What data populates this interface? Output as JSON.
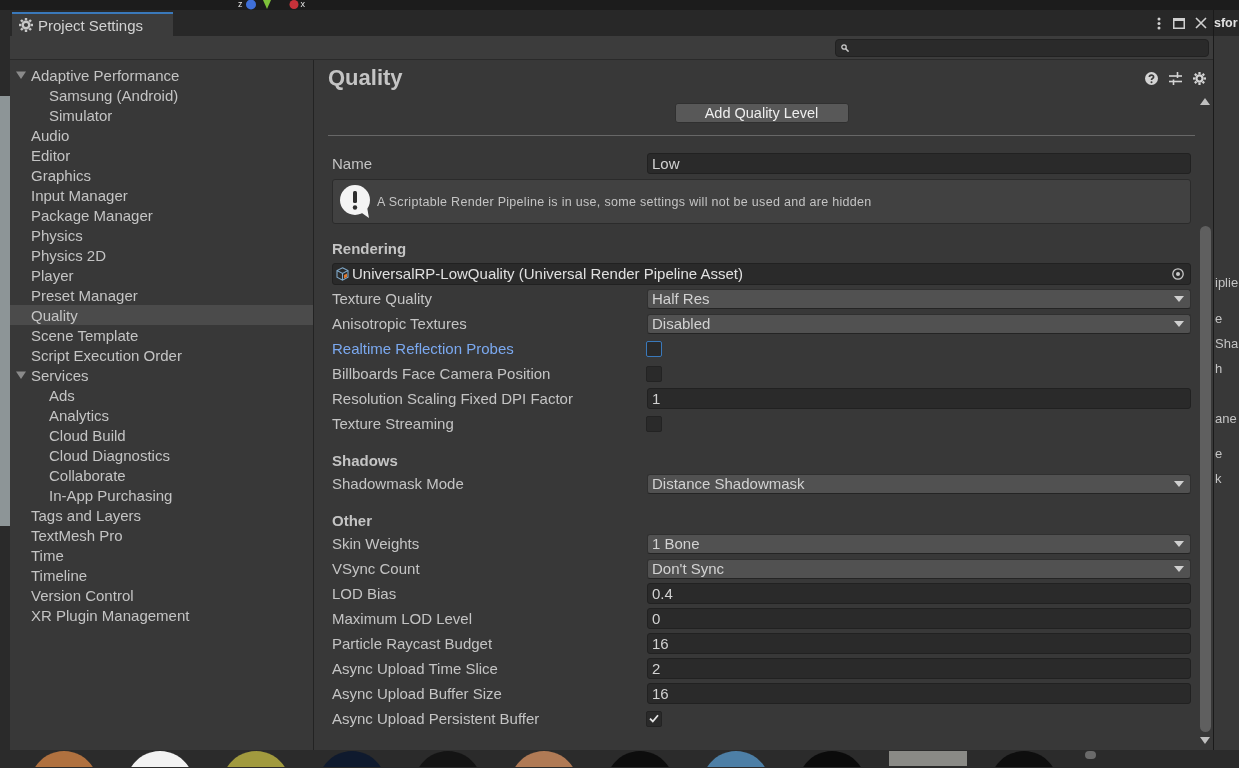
{
  "window": {
    "title": "Project Settings"
  },
  "sidebar": {
    "items": [
      {
        "label": "Adaptive Performance",
        "selected": false,
        "expanded": true,
        "children": [
          {
            "label": "Samsung (Android)",
            "selected": false
          },
          {
            "label": "Simulator",
            "selected": false
          }
        ]
      },
      {
        "label": "Audio",
        "selected": false
      },
      {
        "label": "Editor",
        "selected": false
      },
      {
        "label": "Graphics",
        "selected": false
      },
      {
        "label": "Input Manager",
        "selected": false
      },
      {
        "label": "Package Manager",
        "selected": false
      },
      {
        "label": "Physics",
        "selected": false
      },
      {
        "label": "Physics 2D",
        "selected": false
      },
      {
        "label": "Player",
        "selected": false
      },
      {
        "label": "Preset Manager",
        "selected": false
      },
      {
        "label": "Quality",
        "selected": true
      },
      {
        "label": "Scene Template",
        "selected": false
      },
      {
        "label": "Script Execution Order",
        "selected": false
      },
      {
        "label": "Services",
        "selected": false,
        "expanded": true,
        "children": [
          {
            "label": "Ads",
            "selected": false
          },
          {
            "label": "Analytics",
            "selected": false
          },
          {
            "label": "Cloud Build",
            "selected": false
          },
          {
            "label": "Cloud Diagnostics",
            "selected": false
          },
          {
            "label": "Collaborate",
            "selected": false
          },
          {
            "label": "In-App Purchasing",
            "selected": false
          }
        ]
      },
      {
        "label": "Tags and Layers",
        "selected": false
      },
      {
        "label": "TextMesh Pro",
        "selected": false
      },
      {
        "label": "Time",
        "selected": false
      },
      {
        "label": "Timeline",
        "selected": false
      },
      {
        "label": "Version Control",
        "selected": false
      },
      {
        "label": "XR Plugin Management",
        "selected": false
      }
    ]
  },
  "page": {
    "title": "Quality",
    "add_level_button": "Add Quality Level",
    "name": {
      "label": "Name",
      "value": "Low"
    },
    "notice": "A Scriptable Render Pipeline is in use, some settings will not be used and are hidden",
    "sections": [
      {
        "heading": "Rendering",
        "rows": [
          {
            "kind": "asset",
            "value": "UniversalRP-LowQuality (Universal Render Pipeline Asset)",
            "focused": false
          },
          {
            "kind": "dropdown",
            "label": "Texture Quality",
            "value": "Half Res",
            "focused": false
          },
          {
            "kind": "dropdown",
            "label": "Anisotropic Textures",
            "value": "Disabled",
            "focused": false
          },
          {
            "kind": "checkbox",
            "label": "Realtime Reflection Probes",
            "checked": false,
            "focused": true
          },
          {
            "kind": "checkbox",
            "label": "Billboards Face Camera Position",
            "checked": false,
            "focused": false
          },
          {
            "kind": "number",
            "label": "Resolution Scaling Fixed DPI Factor",
            "value": "1",
            "focused": false
          },
          {
            "kind": "checkbox",
            "label": "Texture Streaming",
            "checked": false,
            "focused": false
          }
        ]
      },
      {
        "heading": "Shadows",
        "rows": [
          {
            "kind": "dropdown",
            "label": "Shadowmask Mode",
            "value": "Distance Shadowmask",
            "focused": false
          }
        ]
      },
      {
        "heading": "Other",
        "rows": [
          {
            "kind": "dropdown",
            "label": "Skin Weights",
            "value": "1 Bone",
            "focused": false
          },
          {
            "kind": "dropdown",
            "label": "VSync Count",
            "value": "Don't Sync",
            "focused": false
          },
          {
            "kind": "number",
            "label": "LOD Bias",
            "value": "0.4",
            "focused": false
          },
          {
            "kind": "number",
            "label": "Maximum LOD Level",
            "value": "0",
            "focused": false
          },
          {
            "kind": "number",
            "label": "Particle Raycast Budget",
            "value": "16",
            "focused": false
          },
          {
            "kind": "number",
            "label": "Async Upload Time Slice",
            "value": "2",
            "focused": false
          },
          {
            "kind": "number",
            "label": "Async Upload Buffer Size",
            "value": "16",
            "focused": false
          },
          {
            "kind": "checkbox",
            "label": "Async Upload Persistent Buffer",
            "checked": true,
            "focused": false
          }
        ]
      }
    ]
  },
  "background": {
    "gizmo_labels": [
      "z",
      "x"
    ],
    "inspector_header": "sfor",
    "inspector_fragments": [
      "iplie",
      "e",
      "Sha",
      "h",
      "ane",
      "e",
      "k"
    ],
    "material_previews": [
      {
        "kind": "sphere",
        "color": "#b0713f"
      },
      {
        "kind": "sphere",
        "color": "#f2f2f2"
      },
      {
        "kind": "sphere",
        "color": "#a19a3e"
      },
      {
        "kind": "sphere",
        "color": "#0f1a2e"
      },
      {
        "kind": "sphere",
        "color": "#141414"
      },
      {
        "kind": "sphere",
        "color": "#b07a55"
      },
      {
        "kind": "sphere",
        "color": "#0d0d0d"
      },
      {
        "kind": "sphere",
        "color": "#4d7fa6"
      },
      {
        "kind": "sphere",
        "color": "#0b0b0b"
      },
      {
        "kind": "square",
        "color": "#8a8a86"
      },
      {
        "kind": "sphere",
        "color": "#0e0e0e"
      }
    ]
  }
}
